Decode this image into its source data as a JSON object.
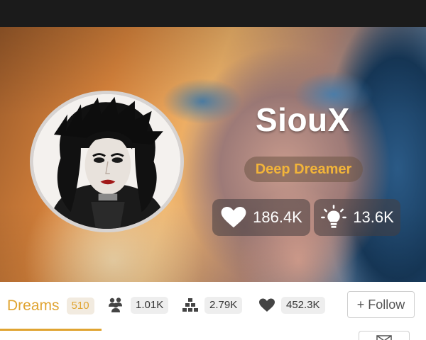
{
  "profile": {
    "username": "SiouX",
    "rank": "Deep Dreamer",
    "likes": "186.4K",
    "ideas": "13.6K"
  },
  "tabs": {
    "dreams_label": "Dreams",
    "dreams_count": "510"
  },
  "stats": {
    "followers": "1.01K",
    "following": "2.79K",
    "hearts": "452.3K"
  },
  "actions": {
    "follow_label": "+ Follow"
  },
  "icons": {
    "likes": "heart-icon",
    "ideas": "lightbulb-icon",
    "followers": "people-icon",
    "following": "pyramid-icon",
    "hearts": "heart-icon",
    "message": "mail-icon"
  },
  "colors": {
    "accent": "#e0a431",
    "topbar": "#1b1b1b",
    "badge_text": "#f2b43a"
  }
}
